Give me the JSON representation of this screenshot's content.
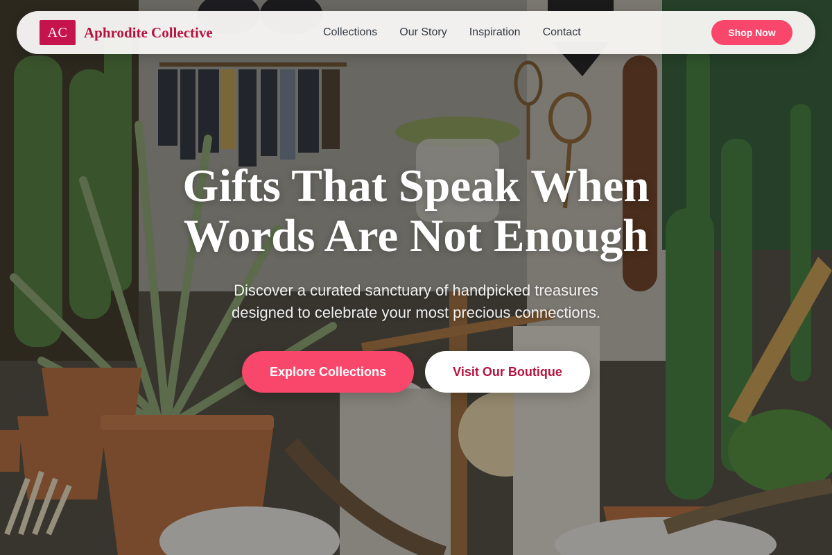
{
  "brand": {
    "mark": "AC",
    "name": "Aphrodite Collective",
    "accent": "#c4134d"
  },
  "nav": {
    "links": [
      "Collections",
      "Our Story",
      "Inspiration",
      "Contact"
    ],
    "cta": "Shop Now",
    "cta_color": "#f8476b"
  },
  "hero": {
    "title_line1": "Gifts That Speak When",
    "title_line2": "Words Are Not Enough",
    "subtitle_line1": "Discover a curated sanctuary of handpicked treasures",
    "subtitle_line2": "designed to celebrate your most precious connections.",
    "primary_button": "Explore Collections",
    "secondary_button": "Visit Our Boutique"
  },
  "background": {
    "description_icon": "boutique-plants-photo"
  }
}
